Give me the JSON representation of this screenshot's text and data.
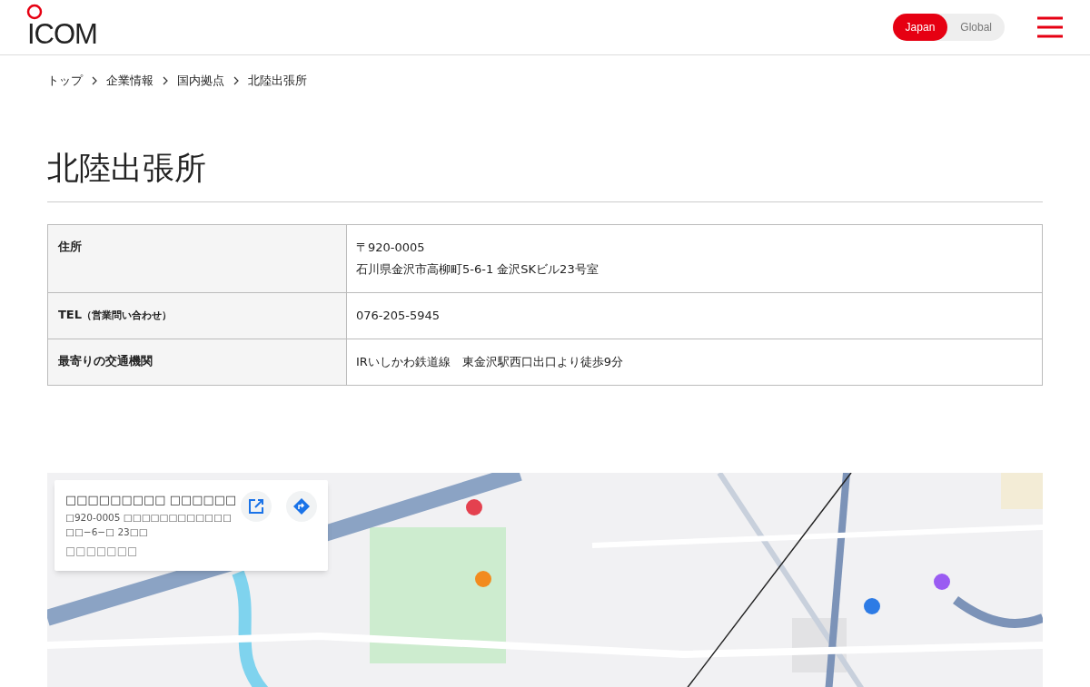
{
  "header": {
    "logo": "ICOM",
    "regions": [
      {
        "label": "Japan",
        "selected": true
      },
      {
        "label": "Global",
        "selected": false
      }
    ]
  },
  "breadcrumb": [
    "トップ",
    "企業情報",
    "国内拠点",
    "北陸出張所"
  ],
  "title": "北陸出張所",
  "table": {
    "rows": [
      {
        "label": "住所",
        "lines": [
          "〒920-0005",
          "石川県金沢市高柳町5-6-1 金沢SKビル23号室"
        ]
      },
      {
        "label": "TEL",
        "label_note": "（営業問い合わせ）",
        "lines": [
          "076-205-5945"
        ]
      },
      {
        "label": "最寄りの交通機関",
        "lines": [
          "IRいしかわ鉄道線　東金沢駅西口出口より徒歩9分"
        ]
      }
    ]
  },
  "map": {
    "kind": "picture",
    "card": {
      "title": "□□□□□□□□□ □□□□□□",
      "address": "□920-0005 □□□□□□□□□□□□□□−6−□ 23□□",
      "link": "□□□□□□□"
    }
  }
}
